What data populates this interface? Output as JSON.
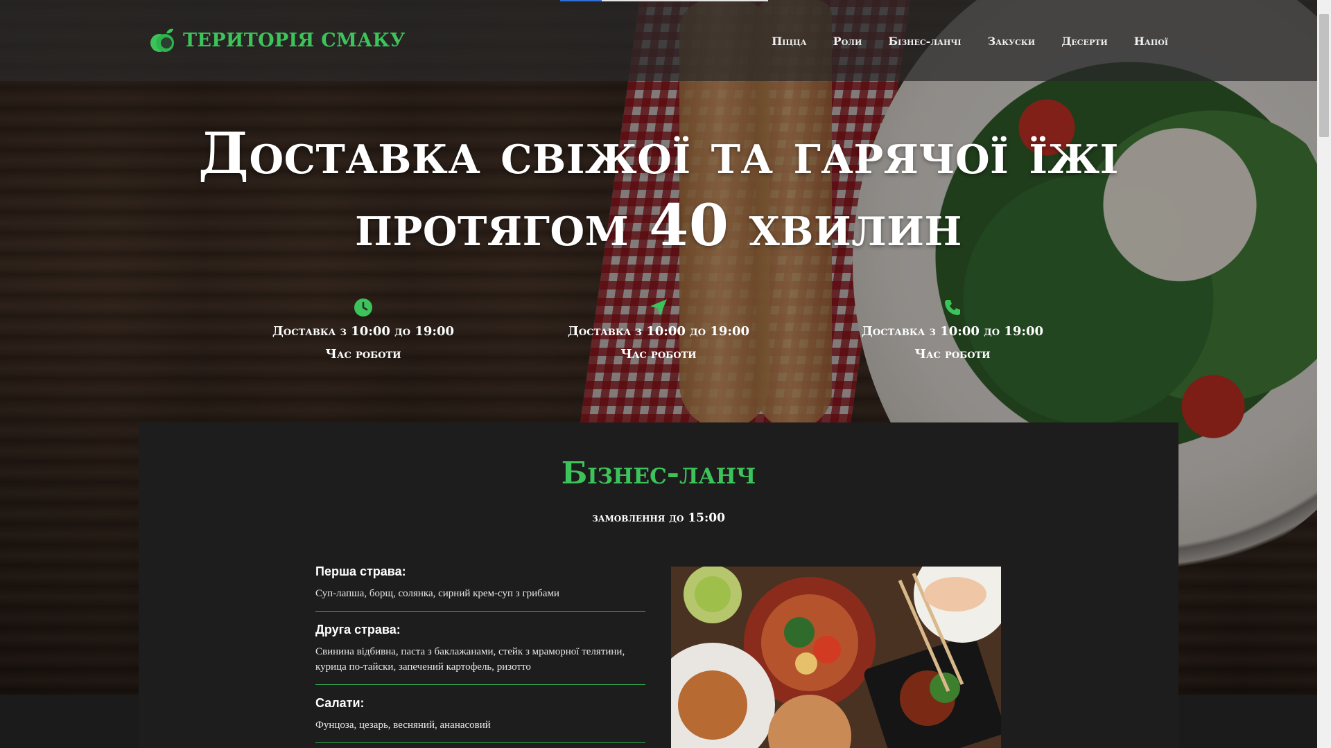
{
  "header": {
    "logo_text": "ТЕРИТОРІЯ СМАКУ",
    "nav": [
      {
        "label": "Піцца"
      },
      {
        "label": "Роли"
      },
      {
        "label": "Бізнес-ланчі"
      },
      {
        "label": "Закуски"
      },
      {
        "label": "Десерти"
      },
      {
        "label": "Напої"
      }
    ]
  },
  "hero": {
    "title_line1": "Доставка свіжої та гарячої їжі",
    "title_line2": "протягом 40 хвилин",
    "features": [
      {
        "icon": "clock-icon",
        "line1": "Доставка з 10:00 до 19:00",
        "line2": "Час роботи"
      },
      {
        "icon": "location-arrow-icon",
        "line1": "Доставка з 10:00 до 19:00",
        "line2": "Час роботи"
      },
      {
        "icon": "phone-icon",
        "line1": "Доставка з 10:00 до 19:00",
        "line2": "Час роботи"
      }
    ]
  },
  "business_lunch": {
    "title": "Бізнес-ланч",
    "subtitle": "замовлення до 15:00",
    "items": [
      {
        "heading": "Перша страва:",
        "text": "Суп-лапша, борщ, солянка, сирний крем-суп з грибами"
      },
      {
        "heading": "Друга страва:",
        "text": "Свинина відбивна, паста з баклажанами, стейк з мраморної телятини, курица по-тайски, запечений картофель, ризотто"
      },
      {
        "heading": "Салати:",
        "text": "Фунцоза, цезарь, весняний, ананасовий"
      }
    ]
  },
  "colors": {
    "accent": "#3cc45a",
    "card_bg": "#1d1d1d"
  }
}
